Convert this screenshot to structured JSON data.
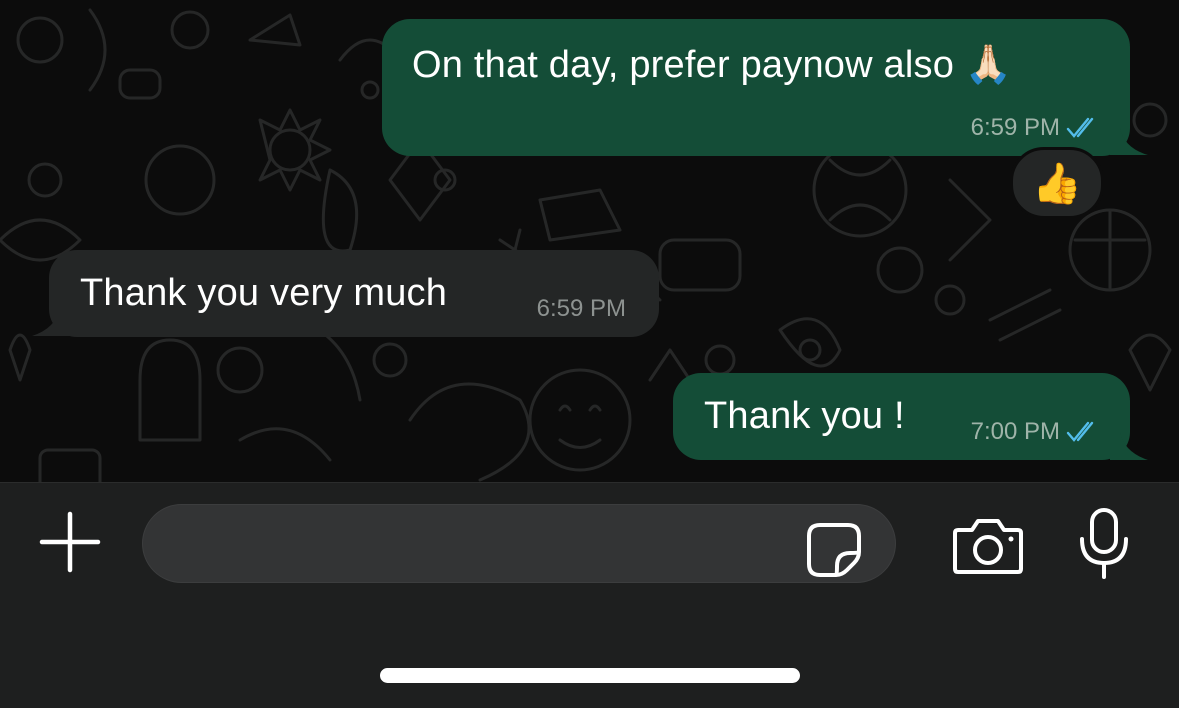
{
  "messages": [
    {
      "direction": "outgoing",
      "text": "On that day, prefer paynow also 🙏🏻",
      "time": "6:59 PM",
      "status": "read"
    },
    {
      "direction": "incoming",
      "text": "Thank you very much",
      "time": "6:59 PM"
    },
    {
      "direction": "outgoing",
      "text": "Thank you !",
      "time": "7:00 PM",
      "status": "read"
    }
  ],
  "reaction": {
    "emoji": "👍"
  },
  "composer": {
    "input_value": "",
    "attach_icon": "plus-icon",
    "sticker_icon": "sticker-icon",
    "camera_icon": "camera-icon",
    "mic_icon": "microphone-icon"
  },
  "colors": {
    "outgoing_bubble": "#144d37",
    "incoming_bubble": "#242626",
    "read_ticks": "#53bdeb",
    "background": "#0c0c0c"
  }
}
